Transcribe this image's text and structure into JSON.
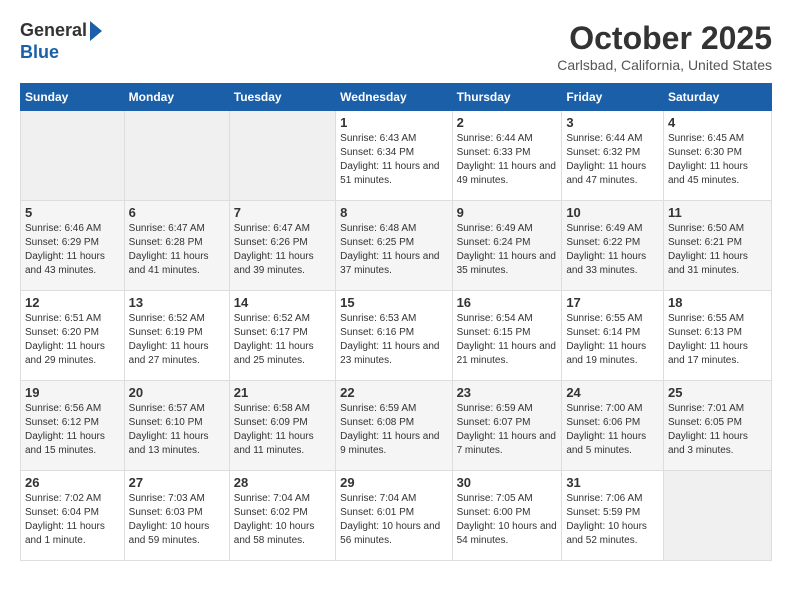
{
  "header": {
    "logo_general": "General",
    "logo_blue": "Blue",
    "title": "October 2025",
    "subtitle": "Carlsbad, California, United States"
  },
  "weekdays": [
    "Sunday",
    "Monday",
    "Tuesday",
    "Wednesday",
    "Thursday",
    "Friday",
    "Saturday"
  ],
  "weeks": [
    [
      {
        "day": "",
        "empty": true
      },
      {
        "day": "",
        "empty": true
      },
      {
        "day": "",
        "empty": true
      },
      {
        "day": "1",
        "sunrise": "Sunrise: 6:43 AM",
        "sunset": "Sunset: 6:34 PM",
        "daylight": "Daylight: 11 hours and 51 minutes."
      },
      {
        "day": "2",
        "sunrise": "Sunrise: 6:44 AM",
        "sunset": "Sunset: 6:33 PM",
        "daylight": "Daylight: 11 hours and 49 minutes."
      },
      {
        "day": "3",
        "sunrise": "Sunrise: 6:44 AM",
        "sunset": "Sunset: 6:32 PM",
        "daylight": "Daylight: 11 hours and 47 minutes."
      },
      {
        "day": "4",
        "sunrise": "Sunrise: 6:45 AM",
        "sunset": "Sunset: 6:30 PM",
        "daylight": "Daylight: 11 hours and 45 minutes."
      }
    ],
    [
      {
        "day": "5",
        "sunrise": "Sunrise: 6:46 AM",
        "sunset": "Sunset: 6:29 PM",
        "daylight": "Daylight: 11 hours and 43 minutes."
      },
      {
        "day": "6",
        "sunrise": "Sunrise: 6:47 AM",
        "sunset": "Sunset: 6:28 PM",
        "daylight": "Daylight: 11 hours and 41 minutes."
      },
      {
        "day": "7",
        "sunrise": "Sunrise: 6:47 AM",
        "sunset": "Sunset: 6:26 PM",
        "daylight": "Daylight: 11 hours and 39 minutes."
      },
      {
        "day": "8",
        "sunrise": "Sunrise: 6:48 AM",
        "sunset": "Sunset: 6:25 PM",
        "daylight": "Daylight: 11 hours and 37 minutes."
      },
      {
        "day": "9",
        "sunrise": "Sunrise: 6:49 AM",
        "sunset": "Sunset: 6:24 PM",
        "daylight": "Daylight: 11 hours and 35 minutes."
      },
      {
        "day": "10",
        "sunrise": "Sunrise: 6:49 AM",
        "sunset": "Sunset: 6:22 PM",
        "daylight": "Daylight: 11 hours and 33 minutes."
      },
      {
        "day": "11",
        "sunrise": "Sunrise: 6:50 AM",
        "sunset": "Sunset: 6:21 PM",
        "daylight": "Daylight: 11 hours and 31 minutes."
      }
    ],
    [
      {
        "day": "12",
        "sunrise": "Sunrise: 6:51 AM",
        "sunset": "Sunset: 6:20 PM",
        "daylight": "Daylight: 11 hours and 29 minutes."
      },
      {
        "day": "13",
        "sunrise": "Sunrise: 6:52 AM",
        "sunset": "Sunset: 6:19 PM",
        "daylight": "Daylight: 11 hours and 27 minutes."
      },
      {
        "day": "14",
        "sunrise": "Sunrise: 6:52 AM",
        "sunset": "Sunset: 6:17 PM",
        "daylight": "Daylight: 11 hours and 25 minutes."
      },
      {
        "day": "15",
        "sunrise": "Sunrise: 6:53 AM",
        "sunset": "Sunset: 6:16 PM",
        "daylight": "Daylight: 11 hours and 23 minutes."
      },
      {
        "day": "16",
        "sunrise": "Sunrise: 6:54 AM",
        "sunset": "Sunset: 6:15 PM",
        "daylight": "Daylight: 11 hours and 21 minutes."
      },
      {
        "day": "17",
        "sunrise": "Sunrise: 6:55 AM",
        "sunset": "Sunset: 6:14 PM",
        "daylight": "Daylight: 11 hours and 19 minutes."
      },
      {
        "day": "18",
        "sunrise": "Sunrise: 6:55 AM",
        "sunset": "Sunset: 6:13 PM",
        "daylight": "Daylight: 11 hours and 17 minutes."
      }
    ],
    [
      {
        "day": "19",
        "sunrise": "Sunrise: 6:56 AM",
        "sunset": "Sunset: 6:12 PM",
        "daylight": "Daylight: 11 hours and 15 minutes."
      },
      {
        "day": "20",
        "sunrise": "Sunrise: 6:57 AM",
        "sunset": "Sunset: 6:10 PM",
        "daylight": "Daylight: 11 hours and 13 minutes."
      },
      {
        "day": "21",
        "sunrise": "Sunrise: 6:58 AM",
        "sunset": "Sunset: 6:09 PM",
        "daylight": "Daylight: 11 hours and 11 minutes."
      },
      {
        "day": "22",
        "sunrise": "Sunrise: 6:59 AM",
        "sunset": "Sunset: 6:08 PM",
        "daylight": "Daylight: 11 hours and 9 minutes."
      },
      {
        "day": "23",
        "sunrise": "Sunrise: 6:59 AM",
        "sunset": "Sunset: 6:07 PM",
        "daylight": "Daylight: 11 hours and 7 minutes."
      },
      {
        "day": "24",
        "sunrise": "Sunrise: 7:00 AM",
        "sunset": "Sunset: 6:06 PM",
        "daylight": "Daylight: 11 hours and 5 minutes."
      },
      {
        "day": "25",
        "sunrise": "Sunrise: 7:01 AM",
        "sunset": "Sunset: 6:05 PM",
        "daylight": "Daylight: 11 hours and 3 minutes."
      }
    ],
    [
      {
        "day": "26",
        "sunrise": "Sunrise: 7:02 AM",
        "sunset": "Sunset: 6:04 PM",
        "daylight": "Daylight: 11 hours and 1 minute."
      },
      {
        "day": "27",
        "sunrise": "Sunrise: 7:03 AM",
        "sunset": "Sunset: 6:03 PM",
        "daylight": "Daylight: 10 hours and 59 minutes."
      },
      {
        "day": "28",
        "sunrise": "Sunrise: 7:04 AM",
        "sunset": "Sunset: 6:02 PM",
        "daylight": "Daylight: 10 hours and 58 minutes."
      },
      {
        "day": "29",
        "sunrise": "Sunrise: 7:04 AM",
        "sunset": "Sunset: 6:01 PM",
        "daylight": "Daylight: 10 hours and 56 minutes."
      },
      {
        "day": "30",
        "sunrise": "Sunrise: 7:05 AM",
        "sunset": "Sunset: 6:00 PM",
        "daylight": "Daylight: 10 hours and 54 minutes."
      },
      {
        "day": "31",
        "sunrise": "Sunrise: 7:06 AM",
        "sunset": "Sunset: 5:59 PM",
        "daylight": "Daylight: 10 hours and 52 minutes."
      },
      {
        "day": "",
        "empty": true
      }
    ]
  ]
}
